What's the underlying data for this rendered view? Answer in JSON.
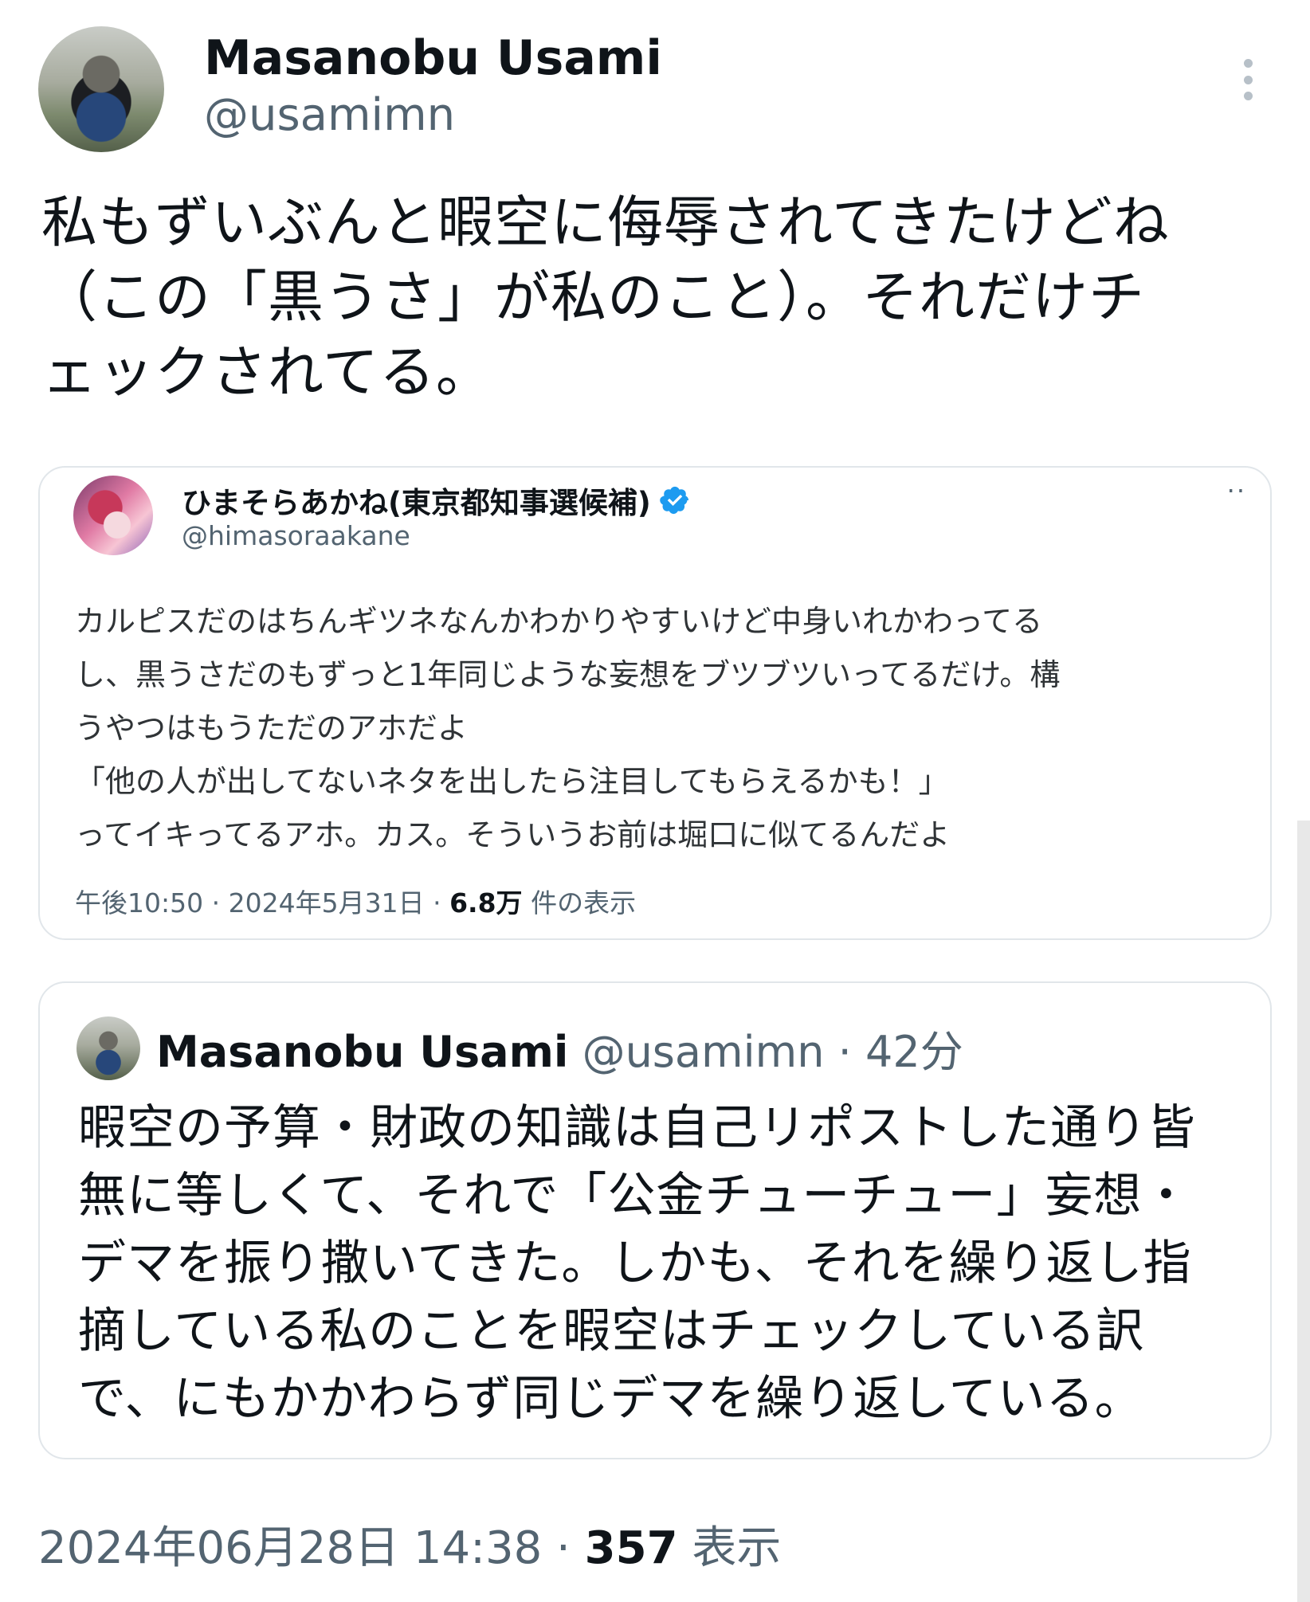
{
  "post": {
    "author_name": "Masanobu Usami",
    "author_handle": "@usamimn",
    "more_icon": "more-vertical-icon",
    "text_lines": [
      "私もずいぶんと暇空に侮辱されてきたけどね",
      "（この「黒うさ」が私のこと）。それだけチ",
      "ェックされてる。"
    ],
    "timestamp": "2024年06月28日 14:38",
    "separator": "·",
    "views_count": "357",
    "views_label": "表示"
  },
  "embedded_post": {
    "author_name": "ひまそらあかね(東京都知事選候補)",
    "verified_icon": "verified-badge-icon",
    "author_handle": "@himasoraakane",
    "more_icon": "more-horizontal-icon",
    "more_glyph": "··",
    "text_lines": [
      "カルピスだのはちんギツネなんかわかりやすいけど中身いれかわってる",
      "し、黒うさだのもずっと1年同じような妄想をブツブツいってるだけ。構",
      "うやつはもうただのアホだよ",
      "「他の人が出してないネタを出したら注目してもらえるかも！」",
      "ってイキってるアホ。カス。そういうお前は堀口に似てるんだよ"
    ],
    "time": "午後10:50",
    "date": "2024年5月31日",
    "separator": "·",
    "views_count": "6.8万",
    "views_label": "件の表示"
  },
  "quoted_post": {
    "author_name": "Masanobu Usami",
    "author_handle": "@usamimn",
    "separator": "·",
    "relative_time": "42分",
    "text_lines": [
      "暇空の予算・財政の知識は自己リポストした通り皆",
      "無に等しくて、それで「公金チューチュー」妄想・",
      "デマを振り撒いてきた。しかも、それを繰り返し指",
      "摘している私のことを暇空はチェックしている訳",
      "で、にもかかわらず同じデマを繰り返している。"
    ]
  },
  "colors": {
    "text_primary": "#0f1419",
    "text_secondary": "#536471",
    "border": "#e1e6ea",
    "verified": "#1d9bf0"
  }
}
